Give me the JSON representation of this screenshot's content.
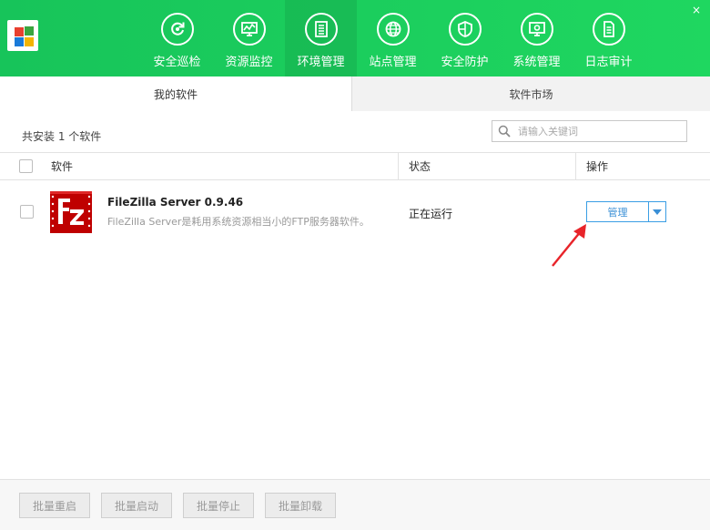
{
  "header": {
    "nav": [
      {
        "label": "安全巡检",
        "icon": "refresh-shield-icon"
      },
      {
        "label": "资源监控",
        "icon": "monitor-chart-icon"
      },
      {
        "label": "环境管理",
        "icon": "server-stack-icon"
      },
      {
        "label": "站点管理",
        "icon": "globe-icon"
      },
      {
        "label": "安全防护",
        "icon": "shield-icon"
      },
      {
        "label": "系统管理",
        "icon": "settings-monitor-icon"
      },
      {
        "label": "日志审计",
        "icon": "document-icon"
      }
    ],
    "active_index": 2,
    "close_glyph": "×"
  },
  "tabs": {
    "my_software": "我的软件",
    "market": "软件市场"
  },
  "toolbar": {
    "count_text": "共安装 1 个软件",
    "search_placeholder": "请输入关键词"
  },
  "table": {
    "headers": {
      "software": "软件",
      "status": "状态",
      "action": "操作"
    },
    "rows": [
      {
        "name": "FileZilla Server 0.9.46",
        "description": "FileZilla Server是耗用系统资源相当小的FTP服务器软件。",
        "status": "正在运行",
        "action_label": "管理"
      }
    ]
  },
  "footer": {
    "batch_restart": "批量重启",
    "batch_start": "批量启动",
    "batch_stop": "批量停止",
    "batch_uninstall": "批量卸载"
  },
  "colors": {
    "header_green": "#1fd760",
    "accent_blue": "#3a9ee4",
    "arrow_red": "#e8242a",
    "filezilla_red": "#bf0000"
  }
}
